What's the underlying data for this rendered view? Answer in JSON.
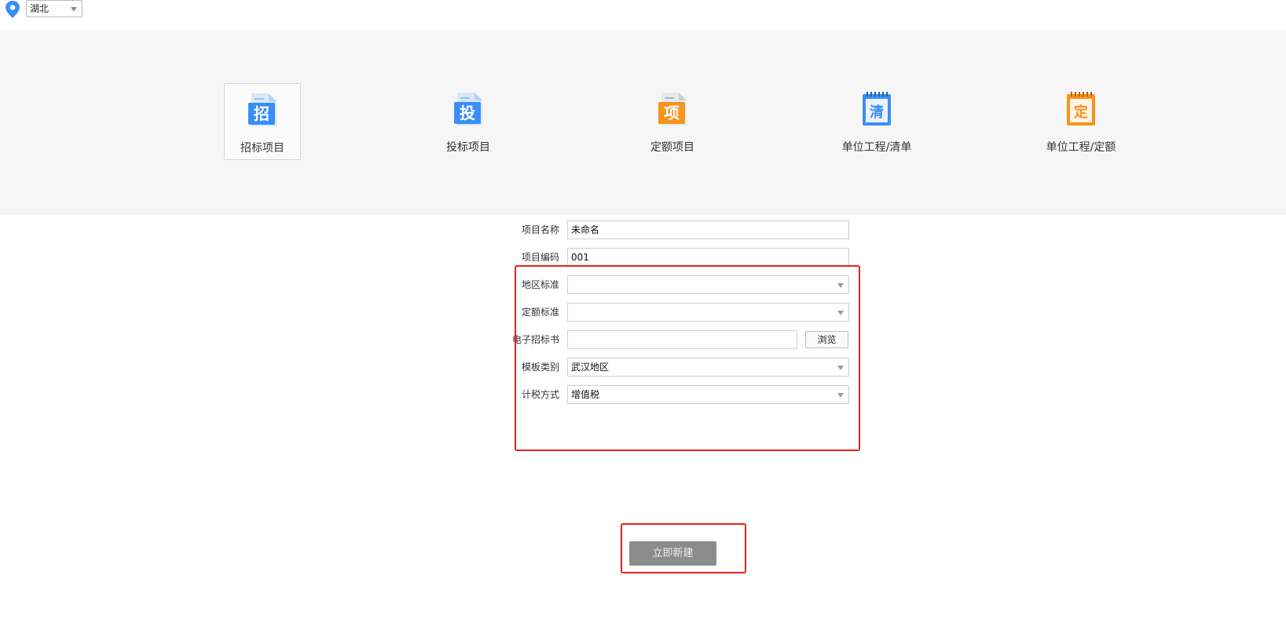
{
  "header": {
    "region": "湖北",
    "icons": {
      "location": "location-pin-icon",
      "dropdown": "chevron-down-icon"
    },
    "accent": "#3b8ef5"
  },
  "project_types": [
    {
      "label": "招标项目",
      "glyph": "招",
      "color": "#3b8ef5",
      "icon": "document-icon",
      "selected": true
    },
    {
      "label": "投标项目",
      "glyph": "投",
      "color": "#3b8ef5",
      "icon": "document-icon",
      "selected": false
    },
    {
      "label": "定额项目",
      "glyph": "项",
      "color": "#f7941d",
      "icon": "document-icon",
      "selected": false
    },
    {
      "label": "单位工程/清单",
      "glyph": "清",
      "color": "#3b8ef5",
      "icon": "notepad-icon",
      "selected": false
    },
    {
      "label": "单位工程/定额",
      "glyph": "定",
      "color": "#f7941d",
      "icon": "notepad-icon",
      "selected": false
    }
  ],
  "form": {
    "project_name": {
      "label": "项目名称",
      "value": "未命名"
    },
    "project_code": {
      "label": "项目编码",
      "value": "001"
    },
    "region_standard": {
      "label": "地区标准",
      "value": ""
    },
    "quota_standard": {
      "label": "定额标准",
      "value": ""
    },
    "e_tender": {
      "label": "电子招标书",
      "value": "",
      "browse_label": "浏览"
    },
    "template_category": {
      "label": "模板类别",
      "value": "武汉地区"
    },
    "tax_method": {
      "label": "计税方式",
      "value": "增值税"
    }
  },
  "actions": {
    "create_label": "立即新建"
  },
  "colors": {
    "annotation": "#e8221b",
    "button_bg": "#8c8c8c",
    "band_bg": "#f6f6f6"
  }
}
